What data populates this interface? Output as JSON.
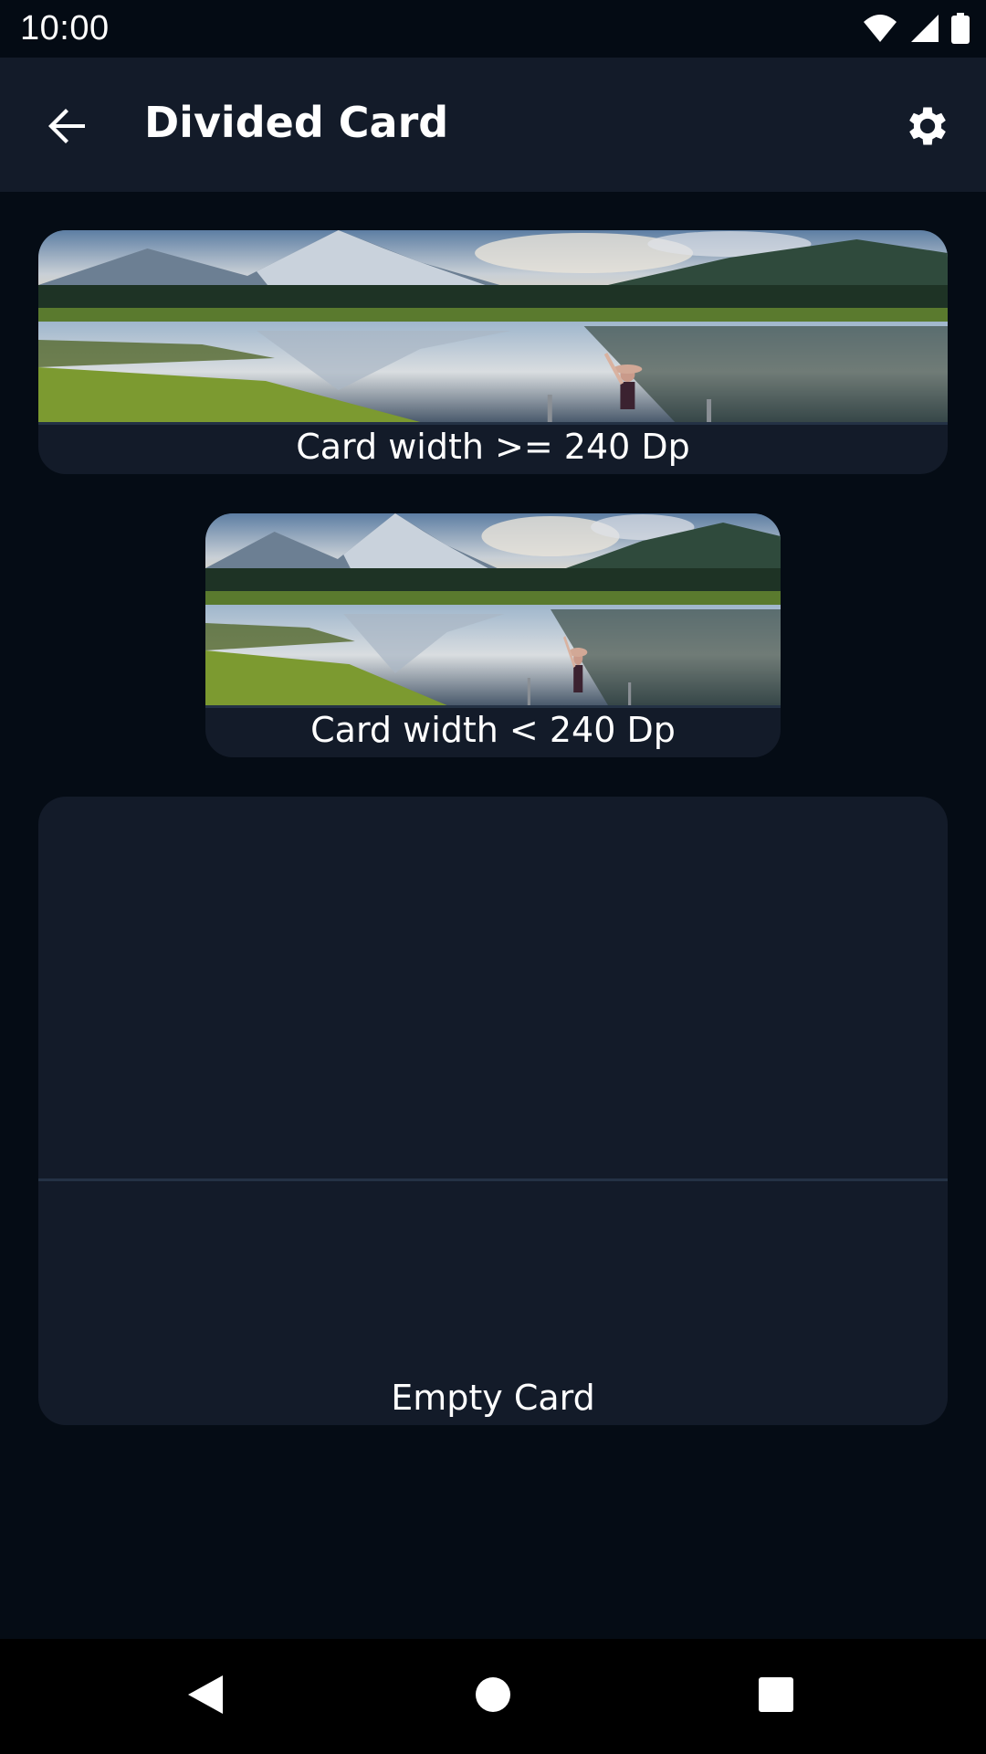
{
  "status_bar": {
    "time": "10:00",
    "icons": [
      "wifi-icon",
      "cellular-signal-icon",
      "battery-icon"
    ]
  },
  "app_bar": {
    "back_icon": "arrow-back-icon",
    "title": "Divided Card",
    "settings_icon": "gear-icon"
  },
  "cards": [
    {
      "label": "Card width >= 240 Dp",
      "image": "mountain-lake-photo"
    },
    {
      "label": "Card width < 240 Dp",
      "image": "mountain-lake-photo"
    },
    {
      "label": "Empty Card"
    }
  ],
  "nav_bar": {
    "icons": [
      "back-triangle-icon",
      "home-circle-icon",
      "recents-square-icon"
    ]
  },
  "colors": {
    "background": "#050c15",
    "surface": "#131b29",
    "divider": "#243245",
    "text": "#ffffff"
  }
}
